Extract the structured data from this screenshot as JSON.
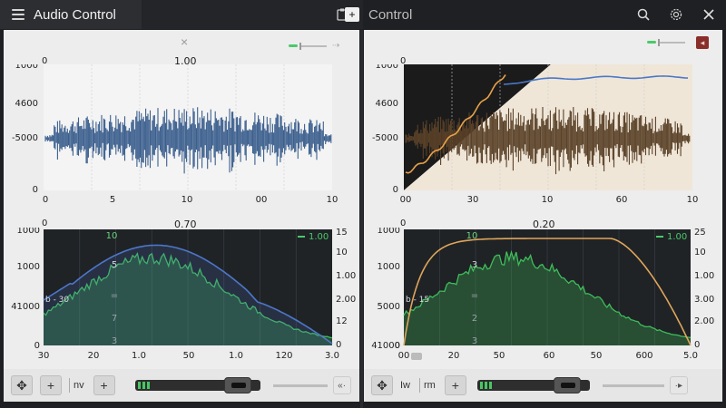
{
  "titlebar": {
    "app_title": "Audio Control",
    "control_title": "Control",
    "icons": [
      "menu-icon",
      "clipboard-icon",
      "plus-icon",
      "search-icon",
      "settings-icon",
      "close-icon"
    ]
  },
  "left_panel": {
    "top_chart": {
      "header_left": "0",
      "header_value": "1.00",
      "y_ticks": [
        "1000",
        "4600",
        "-5000",
        "0"
      ],
      "x_ticks": [
        "0",
        "5",
        "10",
        "00",
        "10"
      ],
      "waveform_color": "#3b5f8e"
    },
    "bottom_chart": {
      "header_left": "0",
      "header_value": "0.70",
      "y_ticks": [
        "1000",
        "1000",
        "41000",
        "0"
      ],
      "y2_ticks": [
        "15",
        "10",
        "1.00",
        "2.00",
        "12",
        "0"
      ],
      "x_ticks": [
        "30",
        "20",
        "1.0",
        "50",
        "1.0",
        "120",
        "3.0"
      ],
      "inner_labels": [
        "10",
        "5",
        "=",
        "7",
        "3",
        "b - 30"
      ],
      "legend": "1.00",
      "line_color": "#4e77c9",
      "area_color": "#3fbd5a"
    },
    "toolbar": {
      "label1": "nv",
      "vol_end": "«·"
    }
  },
  "right_panel": {
    "top_chart": {
      "header_left": "0",
      "header_value": "",
      "y_ticks": [
        "1000",
        "4600",
        "-5000",
        "0"
      ],
      "x_ticks": [
        "00",
        "30",
        "10",
        "60",
        "10"
      ],
      "waveform_color": "#5a4128"
    },
    "bottom_chart": {
      "header_left": "0",
      "header_value": "0.20",
      "y_ticks": [
        "1000",
        "1000",
        "5000",
        "41000",
        "0"
      ],
      "y2_ticks": [
        "25",
        "10",
        "1.00",
        "3.00",
        "2.00",
        "0"
      ],
      "x_ticks": [
        "00",
        "20",
        "50",
        "60",
        "50",
        "600",
        "5.0"
      ],
      "inner_labels": [
        "10",
        "3",
        "=",
        "2",
        "3",
        "b - 15"
      ],
      "legend": "1.00",
      "line_color": "#e0a55a",
      "area_color": "#3fbd5a"
    },
    "toolbar": {
      "label1": "Iw",
      "label2": "rm",
      "vol_end": "·▸"
    }
  }
}
